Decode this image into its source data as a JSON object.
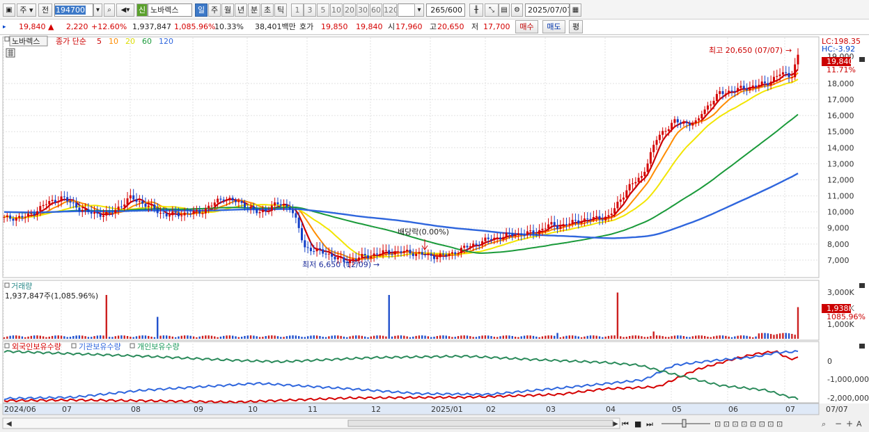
{
  "toolbar": {
    "market_label": "주",
    "prev_label": "전",
    "code": "194700",
    "stock_name": "노바렉스",
    "new_badge": "신",
    "periods": [
      {
        "label": "일",
        "active": true
      },
      {
        "label": "주"
      },
      {
        "label": "월"
      },
      {
        "label": "년"
      },
      {
        "label": "분"
      },
      {
        "label": "초"
      },
      {
        "label": "틱"
      }
    ],
    "minutes": [
      "1",
      "3",
      "5",
      "10",
      "20",
      "30",
      "60",
      "120"
    ],
    "count": "265",
    "count_max": "/600",
    "date": "2025/07/07"
  },
  "quote": {
    "price": "19,840",
    "change": "2,220",
    "change_pct": "+12.60%",
    "volume": "1,937,847",
    "volume_ratio": "1,085.96%",
    "turnover": "10.33%",
    "amount": "38,401백만",
    "ask_label": "호가",
    "ask": "19,850",
    "bid": "19,840",
    "open_label": "시",
    "open": "17,960",
    "high_label": "고",
    "high": "20,650",
    "low_label": "저",
    "low": "17,700",
    "buy_button": "매수",
    "sell_button": "매도",
    "eval_button": "평"
  },
  "price_panel": {
    "stock_tag": "노바렉스",
    "ma_label": "종가 단순",
    "ma_periods": [
      {
        "label": "5",
        "color": "#cc0000"
      },
      {
        "label": "10",
        "color": "#ff8c00"
      },
      {
        "label": "20",
        "color": "#dddd00"
      },
      {
        "label": "60",
        "color": "#1a9a3a"
      },
      {
        "label": "120",
        "color": "#2f66dd"
      }
    ],
    "high_note": "최고 20,650 (07/07)",
    "low_note": "최저 6,650 (12/09)",
    "div_note": "배당락(0.00%)",
    "lc": "LC:198.35",
    "hc": "HC:-3.92",
    "last_price": "19,840",
    "last_pct": "11.71%",
    "yticks": [
      "18,000",
      "17,000",
      "16,000",
      "15,000",
      "14,000",
      "13,000",
      "12,000",
      "11,000",
      "10,000",
      "9,000",
      "8,000",
      "7,000"
    ],
    "ytick_hidden": "19,000"
  },
  "volume_panel": {
    "title": "거래량",
    "current": "1,937,847주(1,085.96%)",
    "yticks": [
      "3,000K",
      "2,000K",
      "1,000K"
    ],
    "last_vol": "1,938K",
    "last_ratio": "1085.96%"
  },
  "holding_panel": {
    "series": [
      {
        "name": "외국인보유수량",
        "color": "#d40000"
      },
      {
        "name": "기관보유수량",
        "color": "#2f66dd"
      },
      {
        "name": "개인보유수량",
        "color": "#1a9a5a"
      }
    ],
    "yticks": [
      "0",
      "-1,000,000",
      "-2,000,000"
    ]
  },
  "xaxis": {
    "labels": [
      "2024/06",
      "07",
      "08",
      "09",
      "10",
      "11",
      "12",
      "2025/01",
      "02",
      "03",
      "04",
      "05",
      "06",
      "07"
    ],
    "right_label": "07/07"
  }
}
